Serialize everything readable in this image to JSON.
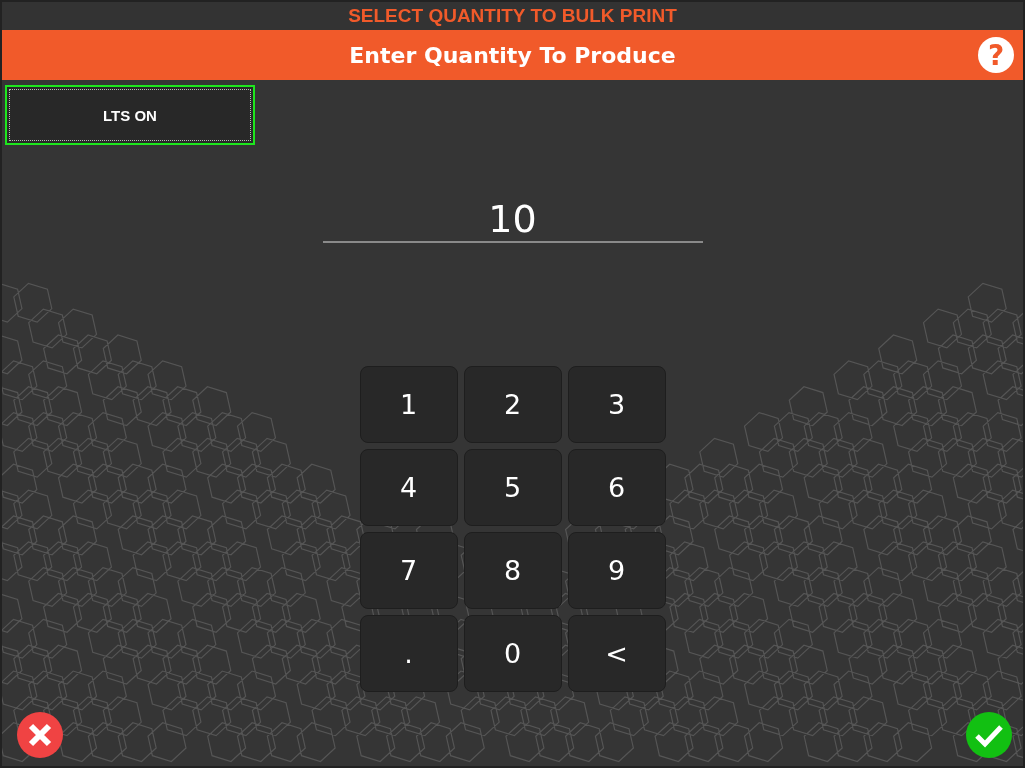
{
  "title_bar": {
    "text": "SELECT QUANTITY TO BULK PRINT"
  },
  "header": {
    "title": "Enter Quantity To Produce",
    "help_label": "?"
  },
  "lts_button": {
    "label": "LTS ON",
    "highlighted": true
  },
  "quantity": {
    "value": "10"
  },
  "keypad": [
    "1",
    "2",
    "3",
    "4",
    "5",
    "6",
    "7",
    "8",
    "9",
    ".",
    "0",
    "<"
  ]
}
